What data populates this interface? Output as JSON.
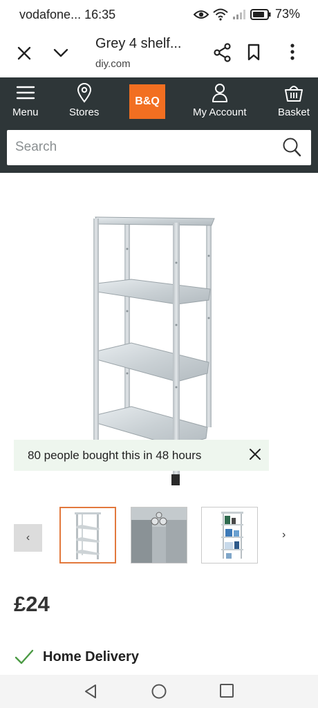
{
  "status_bar": {
    "carrier_time": "vodafone... 16:35",
    "battery": "73%",
    "icons": [
      "eye-icon",
      "wifi-icon",
      "signal-icon",
      "battery-icon"
    ]
  },
  "browser": {
    "page_title": "Grey 4 shelf...",
    "domain": "diy.com",
    "icons": [
      "close-icon",
      "chevron-down-icon",
      "share-icon",
      "bookmark-icon",
      "more-icon"
    ]
  },
  "header": {
    "menu_label": "Menu",
    "stores_label": "Stores",
    "logo_text": "B&Q",
    "account_label": "My Account",
    "basket_label": "Basket",
    "search_placeholder": "Search",
    "brand_color": "#f26f21",
    "header_color": "#2e3638"
  },
  "product": {
    "image_alt": "Grey 4 shelf unit",
    "notice_text": "80 people bought this in 48 hours",
    "price": "£24",
    "delivery_label": "Home Delivery"
  },
  "gallery": {
    "prev_glyph": "‹",
    "next_glyph": "›",
    "selected_index": 0,
    "thumbnails": [
      "shelf-front",
      "shelf-bolt-closeup",
      "shelf-with-items"
    ]
  },
  "system_nav": {
    "icons": [
      "back-icon",
      "home-icon",
      "recents-icon"
    ]
  }
}
